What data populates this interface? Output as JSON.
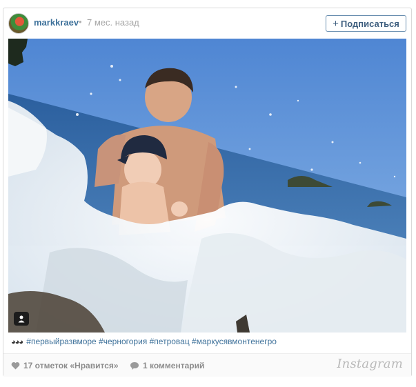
{
  "post": {
    "username": "markkraev",
    "separator": "•",
    "time_ago": "7 мес. назад",
    "follow_label": "Подписаться",
    "follow_icon": "+",
    "caption_emoji": "◕◕◕",
    "caption_tags": "#первыйразвморе #черногория #петровац #маркусявмонтенегро",
    "likes_text": "17 отметок «Нравится»",
    "comments_text": "1 комментарий",
    "brand": "Instagram"
  },
  "colors": {
    "link": "#3f729b",
    "muted": "#a6a6a6"
  }
}
